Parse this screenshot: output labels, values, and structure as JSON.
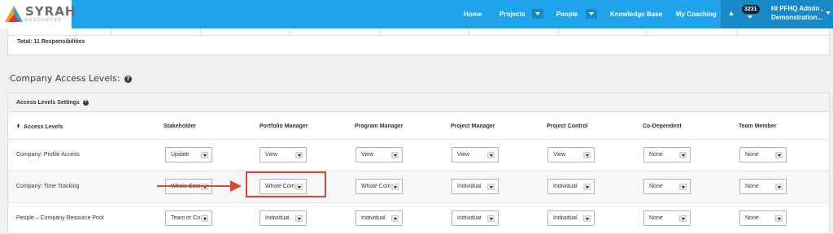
{
  "nav": {
    "logo_text": "SYRAH",
    "logo_subtext": "RESOURCES",
    "items": [
      "Home",
      "Projects",
      "People",
      "Knowledge Base",
      "My Coaching"
    ],
    "notification_count": "3231",
    "user_line1": "Hi PFHQ Admin ,",
    "user_line2": "Demonstration..."
  },
  "responsibilities": {
    "total_label": "Total: 11 Responsibilities"
  },
  "access_levels": {
    "section_title": "Company Access Levels:",
    "panel_title": "Access Levels Settings",
    "columns": [
      "Access Levels",
      "Stakeholder",
      "Portfolio Manager",
      "Program Manager",
      "Project Manager",
      "Project Control",
      "Co-Dependent",
      "Team Member"
    ],
    "rows": [
      {
        "label": "Company: Profile Access",
        "values": [
          "Update",
          "View",
          "View",
          "View",
          "View",
          "None",
          "None"
        ]
      },
      {
        "label": "Company: Time Tracking",
        "values": [
          "Whole Com",
          "Whole Com",
          "Whole Com",
          "Individual",
          "Individual",
          "None",
          "None"
        ]
      },
      {
        "label": "People – Company Resource Pool",
        "values": [
          "Team or Co",
          "Individual",
          "Individual",
          "Individual",
          "Individual",
          "None",
          "None"
        ]
      }
    ]
  },
  "colors": {
    "nav_blue": "#1fa3ea",
    "annotation_red": "#e5452f"
  },
  "icons": [
    "warning-icon",
    "bell-icon",
    "help-circle-icon",
    "sort-icon",
    "chevron-down-icon"
  ]
}
